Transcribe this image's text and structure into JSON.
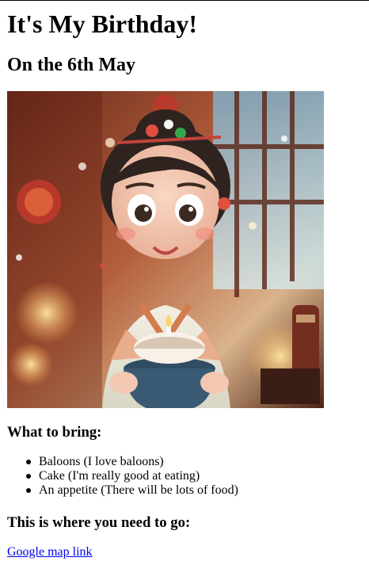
{
  "page": {
    "title": "It's My Birthday!",
    "subtitle": "On the 6th May"
  },
  "image": {
    "subject": "cartoon girl holding a cake"
  },
  "bring": {
    "heading": "What to bring:",
    "items": [
      "Baloons (I love baloons)",
      "Cake (I'm really good at eating)",
      "An appetite (There will be lots of food)"
    ]
  },
  "location": {
    "heading": "This is where you need to go:",
    "link_text": "Google map link"
  },
  "colors": {
    "link": "#0000ee",
    "text": "#000000",
    "background": "#ffffff"
  }
}
